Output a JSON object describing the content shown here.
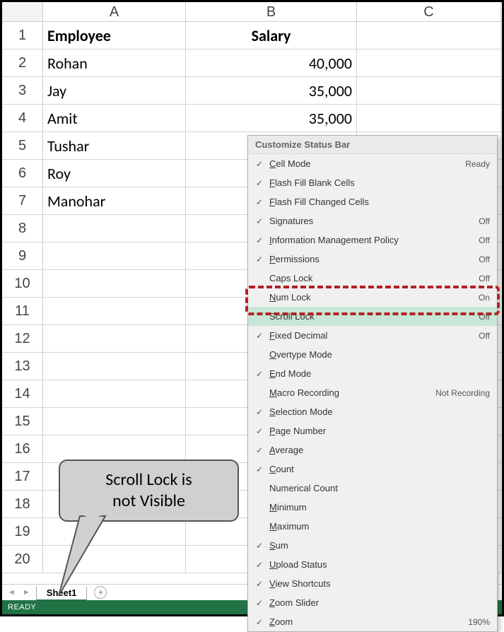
{
  "columns": [
    "A",
    "B",
    "C"
  ],
  "row_numbers": [
    1,
    2,
    3,
    4,
    5,
    6,
    7,
    8,
    9,
    10,
    11,
    12,
    13,
    14,
    15,
    16,
    17,
    18,
    19,
    20
  ],
  "cells": {
    "header_employee": "Employee",
    "header_salary": "Salary",
    "r2a": "Rohan",
    "r2b": "40,000",
    "r3a": "Jay",
    "r3b": "35,000",
    "r4a": "Amit",
    "r4b": "35,000",
    "r5a": "Tushar",
    "r6a": "Roy",
    "r7a": "Manohar"
  },
  "sheet_tab": "Sheet1",
  "status_text": "READY",
  "context_menu": {
    "title": "Customize Status Bar",
    "items": [
      {
        "checked": true,
        "label": "Cell Mode",
        "uchar": "C",
        "rest": "ell Mode",
        "status": "Ready"
      },
      {
        "checked": true,
        "label": "Flash Fill Blank Cells",
        "uchar": "F",
        "rest": "lash Fill Blank Cells",
        "status": ""
      },
      {
        "checked": true,
        "label": "Flash Fill Changed Cells",
        "uchar": "F",
        "rest": "lash Fill Changed Cells",
        "status": ""
      },
      {
        "checked": true,
        "label": "Signatures",
        "uchar": "",
        "rest": "Signatures",
        "status": "Off"
      },
      {
        "checked": true,
        "label": "Information Management Policy",
        "uchar": "I",
        "rest": "nformation Management Policy",
        "status": "Off"
      },
      {
        "checked": true,
        "label": "Permissions",
        "uchar": "P",
        "rest": "ermissions",
        "status": "Off"
      },
      {
        "checked": false,
        "label": "Caps Lock",
        "uchar": "",
        "rest": "Caps Lock",
        "status": "Off"
      },
      {
        "checked": false,
        "label": "Num Lock",
        "uchar": "N",
        "rest": "um Lock",
        "status": "On"
      },
      {
        "checked": false,
        "label": "Scroll Lock",
        "uchar": "",
        "rest": "Scroll Lock",
        "status": "Off",
        "highlighted": true
      },
      {
        "checked": true,
        "label": "Fixed Decimal",
        "uchar": "F",
        "rest": "ixed Decimal",
        "status": "Off"
      },
      {
        "checked": false,
        "label": "Overtype Mode",
        "uchar": "O",
        "rest": "vertype Mode",
        "status": ""
      },
      {
        "checked": true,
        "label": "End Mode",
        "uchar": "E",
        "rest": "nd Mode",
        "status": ""
      },
      {
        "checked": false,
        "label": "Macro Recording",
        "uchar": "M",
        "rest": "acro Recording",
        "status": "Not Recording"
      },
      {
        "checked": true,
        "label": "Selection Mode",
        "uchar": "S",
        "rest": "election Mode",
        "status": ""
      },
      {
        "checked": true,
        "label": "Page Number",
        "uchar": "P",
        "rest": "age Number",
        "status": ""
      },
      {
        "checked": true,
        "label": "Average",
        "uchar": "A",
        "rest": "verage",
        "status": ""
      },
      {
        "checked": true,
        "label": "Count",
        "uchar": "C",
        "rest": "ount",
        "status": ""
      },
      {
        "checked": false,
        "label": "Numerical Count",
        "uchar": "",
        "rest": "Numerical Count",
        "status": ""
      },
      {
        "checked": false,
        "label": "Minimum",
        "uchar": "M",
        "rest": "inimum",
        "status": ""
      },
      {
        "checked": false,
        "label": "Maximum",
        "uchar": "M",
        "rest": "aximum",
        "status": ""
      },
      {
        "checked": true,
        "label": "Sum",
        "uchar": "S",
        "rest": "um",
        "status": ""
      },
      {
        "checked": true,
        "label": "Upload Status",
        "uchar": "U",
        "rest": "pload Status",
        "status": ""
      },
      {
        "checked": true,
        "label": "View Shortcuts",
        "uchar": "V",
        "rest": "iew Shortcuts",
        "status": ""
      },
      {
        "checked": true,
        "label": "Zoom Slider",
        "uchar": "Z",
        "rest": "oom Slider",
        "status": ""
      },
      {
        "checked": true,
        "label": "Zoom",
        "uchar": "Z",
        "rest": "oom",
        "status": "190%"
      }
    ]
  },
  "callout": {
    "line1": "Scroll Lock is",
    "line2": "not Visible"
  }
}
